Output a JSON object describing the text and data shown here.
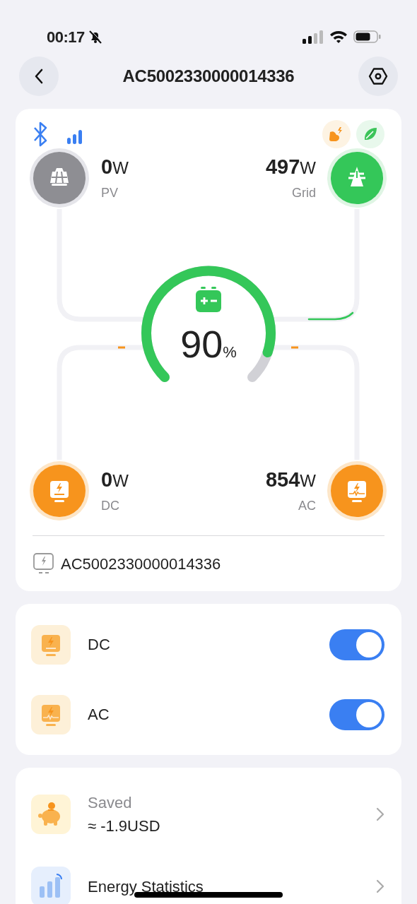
{
  "status_bar": {
    "time": "00:17",
    "silent": true
  },
  "header": {
    "title": "AC5002330000014336"
  },
  "flow": {
    "nodes": [
      {
        "kind": "pv",
        "value": "0",
        "unit": "W",
        "label": "PV"
      },
      {
        "kind": "grid",
        "value": "497",
        "unit": "W",
        "label": "Grid"
      },
      {
        "kind": "dc",
        "value": "0",
        "unit": "W",
        "label": "DC"
      },
      {
        "kind": "ac",
        "value": "854",
        "unit": "W",
        "label": "AC"
      }
    ],
    "battery": {
      "value": "90",
      "unit": "%"
    }
  },
  "device": {
    "name": "AC5002330000014336"
  },
  "outputs": [
    {
      "kind": "dc",
      "label": "DC",
      "on": true
    },
    {
      "kind": "ac",
      "label": "AC",
      "on": true
    }
  ],
  "menu": [
    {
      "kind": "saved",
      "label": "Saved",
      "value": "≈ -1.9USD"
    },
    {
      "kind": "stats",
      "label": "Energy Statistics"
    }
  ]
}
